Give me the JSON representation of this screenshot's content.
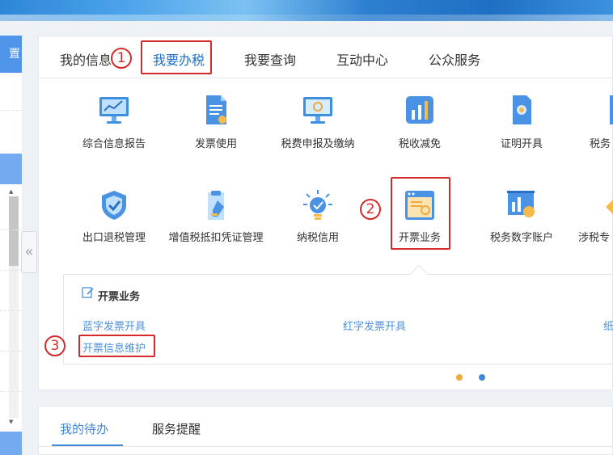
{
  "sidebar": {
    "heading": "置"
  },
  "tabs": [
    {
      "label": "我的信息"
    },
    {
      "label": "我要办税"
    },
    {
      "label": "我要查询"
    },
    {
      "label": "互动中心"
    },
    {
      "label": "公众服务"
    }
  ],
  "annotations": [
    "1",
    "2",
    "3"
  ],
  "services_row1": [
    {
      "label": "综合信息报告",
      "icon": "monitor-chart-icon"
    },
    {
      "label": "发票使用",
      "icon": "invoice-doc-icon"
    },
    {
      "label": "税费申报及缴纳",
      "icon": "monitor-refresh-icon"
    },
    {
      "label": "税收减免",
      "icon": "bar-chart-icon"
    },
    {
      "label": "证明开具",
      "icon": "certificate-icon"
    },
    {
      "label": "税务",
      "icon": "doc-icon"
    }
  ],
  "services_row2": [
    {
      "label": "出口退税管理",
      "icon": "shield-check-icon"
    },
    {
      "label": "增值税抵扣凭证管理",
      "icon": "pen-doc-icon"
    },
    {
      "label": "纳税信用",
      "icon": "lightbulb-icon"
    },
    {
      "label": "开票业务",
      "icon": "invoice-window-icon"
    },
    {
      "label": "税务数字账户",
      "icon": "account-chart-icon"
    },
    {
      "label": "涉税专",
      "icon": "diamond-icon"
    }
  ],
  "popup": {
    "title": "开票业务",
    "links": [
      "蓝字发票开具",
      "红字发票开具",
      "纸",
      "开票信息维护"
    ]
  },
  "bottom_tabs": [
    {
      "label": "我的待办"
    },
    {
      "label": "服务提醒"
    }
  ],
  "colors": {
    "accent": "#3c87d8",
    "annotation": "#d42a2a",
    "link": "#4e91d7"
  }
}
